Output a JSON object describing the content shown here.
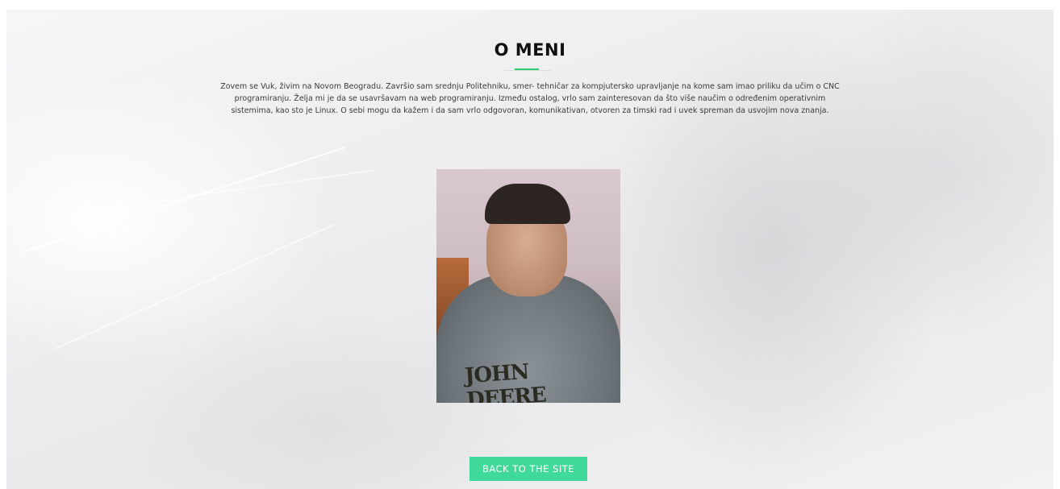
{
  "about": {
    "title": "O MENI",
    "text": "Zovem se Vuk, živim na Novom Beogradu. Završio sam srednju Politehniku, smer- tehničar za kompjutersko upravljanje na kome sam imao priliku da učim o CNC programiranju. Želja mi je da se usavršavam na web programiranju. Između ostalog, vrlo sam zainteresovan da što više naučim o određenim operativnim sistemima, kao sto je Linux. O sebi mogu da kažem i da sam vrlo odgovoran, komunikativan, otvoren za timski rad i uvek spreman da usvojim nova znanja.",
    "photo_caption": "JOHN DEERE"
  },
  "actions": {
    "back_label": "BACK TO THE SITE"
  },
  "colors": {
    "accent": "#2ecc71",
    "button": "#3fd99a"
  }
}
